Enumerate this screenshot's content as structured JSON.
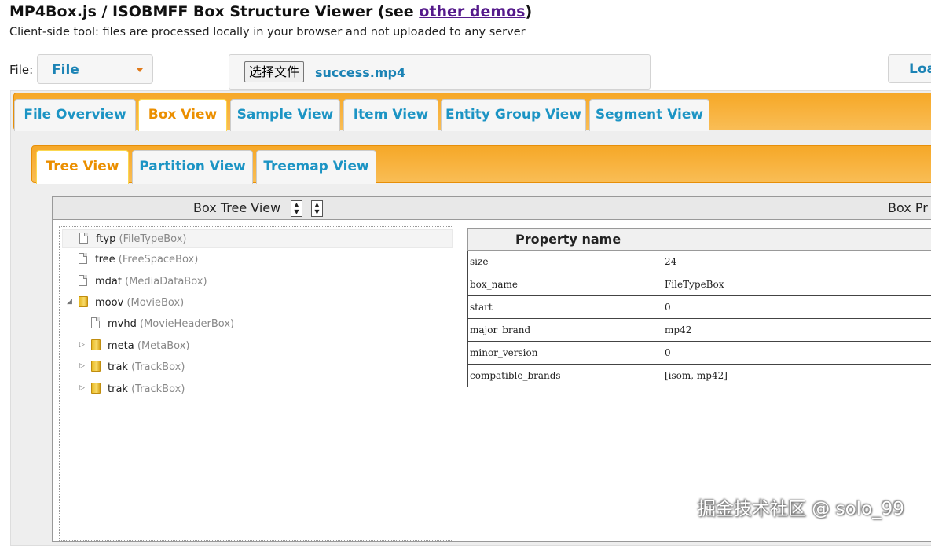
{
  "header": {
    "title_prefix": "MP4Box.js / ISOBMFF Box Structure Viewer (see ",
    "title_link": "other demos",
    "title_suffix": ")",
    "subtitle": "Client-side tool: files are processed locally in your browser and not uploaded to any server"
  },
  "file_row": {
    "label": "File:",
    "source_select": "File",
    "choose_button": "选择文件",
    "filename": "success.mp4",
    "load_button": "Load"
  },
  "main_tabs": [
    {
      "label": "File Overview",
      "active": false
    },
    {
      "label": "Box View",
      "active": true
    },
    {
      "label": "Sample View",
      "active": false
    },
    {
      "label": "Item View",
      "active": false
    },
    {
      "label": "Entity Group View",
      "active": false
    },
    {
      "label": "Segment View",
      "active": false
    }
  ],
  "sub_tabs": [
    {
      "label": "Tree View",
      "active": true
    },
    {
      "label": "Partition View",
      "active": false
    },
    {
      "label": "Treemap View",
      "active": false
    }
  ],
  "tree_panel": {
    "title": "Box Tree View",
    "props_title": "Box Pr",
    "sort_up": "▲",
    "sort_down": "▼",
    "nodes": [
      {
        "name": "ftyp",
        "type": "(FileTypeBox)",
        "icon": "file-icon",
        "selected": true
      },
      {
        "name": "free",
        "type": "(FreeSpaceBox)",
        "icon": "file-icon"
      },
      {
        "name": "mdat",
        "type": "(MediaDataBox)",
        "icon": "file-icon"
      },
      {
        "name": "moov",
        "type": "(MovieBox)",
        "icon": "folder-icon",
        "expander": "◢"
      },
      {
        "name": "mvhd",
        "type": "(MovieHeaderBox)",
        "icon": "file-icon"
      },
      {
        "name": "meta",
        "type": "(MetaBox)",
        "icon": "folder-icon",
        "expander": "▷"
      },
      {
        "name": "trak",
        "type": "(TrackBox)",
        "icon": "folder-icon",
        "expander": "▷"
      },
      {
        "name": "trak",
        "type": "(TrackBox)",
        "icon": "folder-icon",
        "expander": "▷"
      }
    ]
  },
  "properties": {
    "header": "Property name",
    "rows": [
      {
        "name": "size",
        "value": "24"
      },
      {
        "name": "box_name",
        "value": "FileTypeBox"
      },
      {
        "name": "start",
        "value": "0"
      },
      {
        "name": "major_brand",
        "value": "mp42"
      },
      {
        "name": "minor_version",
        "value": "0"
      },
      {
        "name": "compatible_brands",
        "value": "[isom, mp42]"
      }
    ]
  },
  "watermark": "掘金技术社区 @ solo_99",
  "colors": {
    "accent_orange": "#f6a828",
    "tab_text": "#1c94c4",
    "active_tab_text": "#eb8f00"
  }
}
